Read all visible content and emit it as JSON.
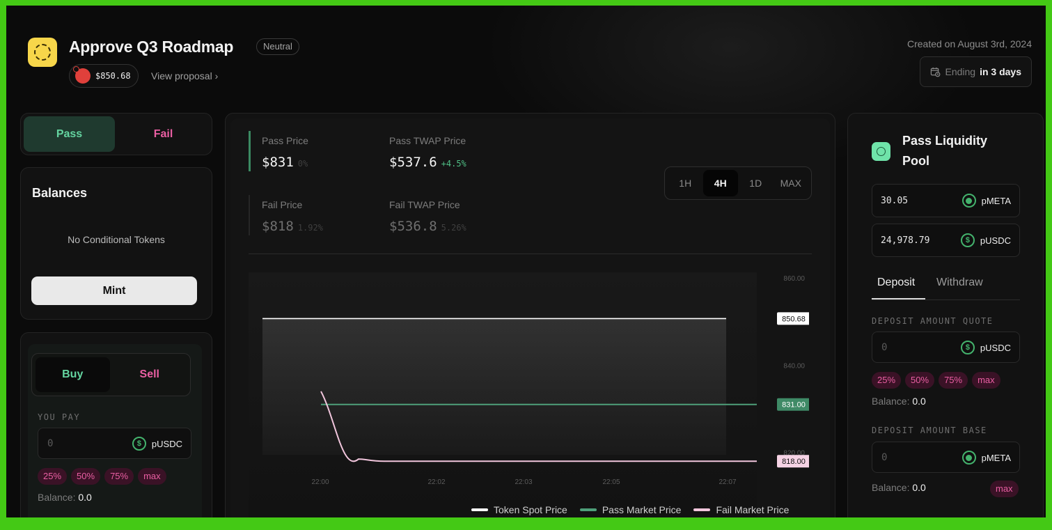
{
  "header": {
    "title": "Approve Q3 Roadmap",
    "badge": "Neutral",
    "token_price": "$850.68",
    "view_proposal": "View proposal ›",
    "created": "Created on August 3rd, 2024",
    "ending_prefix": "Ending",
    "ending_value": "in 3 days"
  },
  "left": {
    "pass_tab": "Pass",
    "fail_tab": "Fail",
    "balances_title": "Balances",
    "no_tokens": "No Conditional Tokens",
    "mint": "Mint",
    "buy_tab": "Buy",
    "sell_tab": "Sell",
    "you_pay_label": "YOU PAY",
    "input_placeholder": "0",
    "token": "pUSDC",
    "percents": [
      "25%",
      "50%",
      "75%",
      "max"
    ],
    "balance_label": "Balance:",
    "balance_value": "0.0"
  },
  "center": {
    "pass_price_label": "Pass Price",
    "pass_price": "$831",
    "pass_price_change": "0%",
    "pass_twap_label": "Pass TWAP Price",
    "pass_twap": "$537.6",
    "pass_twap_change": "+4.5%",
    "fail_price_label": "Fail Price",
    "fail_price": "$818",
    "fail_price_change": "1.92%",
    "fail_twap_label": "Fail TWAP Price",
    "fail_twap": "$536.8",
    "fail_twap_change": "5.26%",
    "timeframes": [
      "1H",
      "4H",
      "1D",
      "MAX"
    ],
    "active_timeframe": "4H"
  },
  "chart_data": {
    "type": "line",
    "ylim": [
      815,
      860
    ],
    "yticks": [
      "860.00",
      "840.00",
      "820.00"
    ],
    "xticks": [
      "22:00",
      "22:02",
      "22:03",
      "22:05",
      "22:07"
    ],
    "series": [
      {
        "name": "Token Spot Price",
        "color": "#ffffff",
        "x": [
          "22:00",
          "22:07"
        ],
        "values": [
          850.68,
          850.68
        ],
        "last_label": "850.68"
      },
      {
        "name": "Pass Market Price",
        "color": "#4ea07a",
        "x": [
          "22:01",
          "22:08"
        ],
        "values": [
          831,
          831
        ],
        "last_label": "831.00"
      },
      {
        "name": "Fail Market Price",
        "color": "#f2c6dd",
        "x": [
          "22:01",
          "22:01",
          "22:02",
          "22:08"
        ],
        "values": [
          834,
          820,
          818,
          818
        ],
        "last_label": "818.00"
      }
    ]
  },
  "right": {
    "pool_title": "Pass Liquidity Pool",
    "liquidity": [
      {
        "amount": "30.05",
        "token": "pMETA"
      },
      {
        "amount": "24,978.79",
        "token": "pUSDC"
      }
    ],
    "deposit_tab": "Deposit",
    "withdraw_tab": "Withdraw",
    "quote_label": "DEPOSIT AMOUNT QUOTE",
    "quote_placeholder": "0",
    "quote_token": "pUSDC",
    "percents": [
      "25%",
      "50%",
      "75%",
      "max"
    ],
    "balance_label": "Balance:",
    "balance_value": "0.0",
    "base_label": "DEPOSIT AMOUNT BASE",
    "base_placeholder": "0",
    "base_token": "pMETA",
    "base_balance_label": "Balance:",
    "base_balance_value": "0.0",
    "base_max": "max"
  }
}
